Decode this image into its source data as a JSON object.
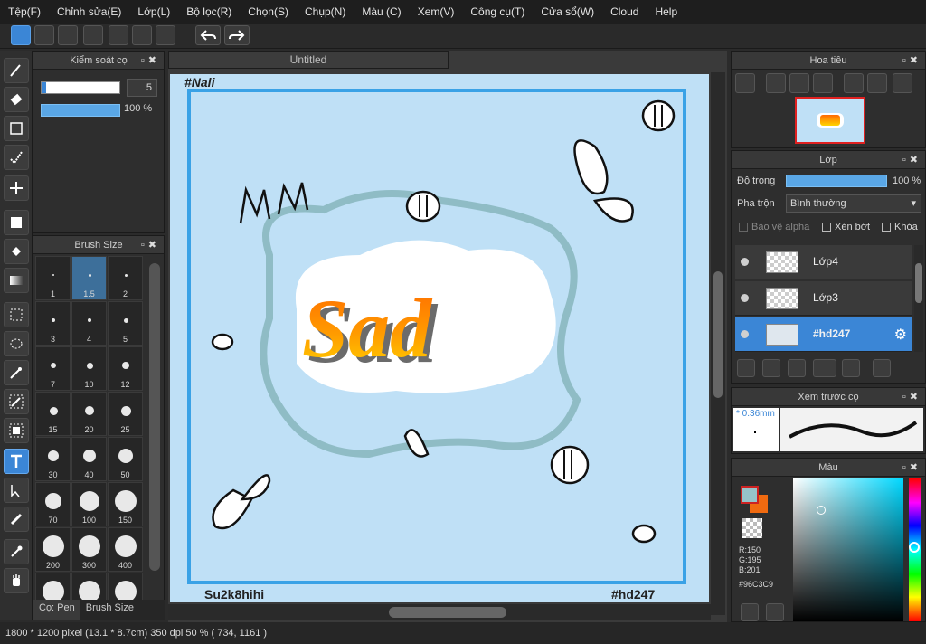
{
  "menu": [
    "Tệp(F)",
    "Chỉnh sửa(E)",
    "Lớp(L)",
    "Bộ lọc(R)",
    "Chọn(S)",
    "Chụp(N)",
    "Màu (C)",
    "Xem(V)",
    "Công cụ(T)",
    "Cửa sổ(W)",
    "Cloud",
    "Help"
  ],
  "brush_control": {
    "title": "Kiểm soát cọ",
    "size": "5",
    "opacity": "100 %"
  },
  "brush_size": {
    "title": "Brush Size",
    "sizes": [
      "1",
      "1.5",
      "2",
      "3",
      "4",
      "5",
      "7",
      "10",
      "12",
      "15",
      "20",
      "25",
      "30",
      "40",
      "50",
      "70",
      "100",
      "150",
      "200",
      "300",
      "400",
      "",
      "",
      ""
    ],
    "selected": "1.5",
    "tabs": [
      "Cọ: Pen",
      "Brush Size"
    ]
  },
  "document": {
    "tab": "Untitled",
    "top_left_text": "#Nali",
    "bottom_left_text": "Su2k8hihi",
    "bottom_right_text": "#hd247",
    "main_text": "Sad"
  },
  "navigator": {
    "title": "Hoa tiêu"
  },
  "layers": {
    "title": "Lớp",
    "opacity_label": "Độ trong",
    "opacity_value": "100 %",
    "blend_label": "Pha trộn",
    "blend_value": "Bình thường",
    "protect_alpha": "Bảo vệ alpha",
    "clip": "Xén bớt",
    "lock": "Khóa",
    "items": [
      {
        "name": "Lớp4"
      },
      {
        "name": "Lớp3"
      },
      {
        "name": "#hd247"
      }
    ],
    "selected": "#hd247"
  },
  "preview": {
    "title": "Xem trước cọ",
    "size": "0.36mm"
  },
  "color": {
    "title": "Màu",
    "r": "R:150",
    "g": "G:195",
    "b": "B:201",
    "hex": "#96C3C9",
    "fg": "#96C3C9",
    "bg": "#f06a10"
  },
  "status": {
    "text": "1800 * 1200 pixel  (13.1 * 8.7cm)  350 dpi  50 %  ( 734, 1161 )"
  }
}
